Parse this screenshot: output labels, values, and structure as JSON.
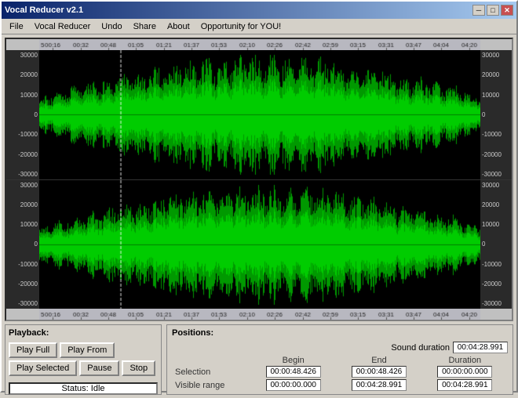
{
  "window": {
    "title": "Vocal Reducer v2.1",
    "minimize_label": "─",
    "maximize_label": "□",
    "close_label": "✕"
  },
  "menu": {
    "items": [
      {
        "label": "File"
      },
      {
        "label": "Vocal Reducer"
      },
      {
        "label": "Undo"
      },
      {
        "label": "Share"
      },
      {
        "label": "About"
      },
      {
        "label": "Opportunity for YOU!"
      }
    ]
  },
  "timeline": {
    "markers": [
      "00:16",
      "00:32",
      "00:48",
      "01:05",
      "01:21",
      "01:37",
      "01:53",
      "02:10",
      "02:26",
      "02:42",
      "02:59",
      "03:15",
      "03:31",
      "03:47",
      "04:04",
      "04:20"
    ]
  },
  "yaxis": {
    "channel1_left": [
      "30000",
      "20000",
      "10000",
      "0",
      "-10000",
      "-20000",
      "-30000"
    ],
    "channel1_right": [
      "30000",
      "20000",
      "10000",
      "0",
      "-10000",
      "-20000",
      "-30000"
    ],
    "channel2_left": [
      "30000",
      "20000",
      "10000",
      "0",
      "-10000",
      "-20000",
      "-30000"
    ],
    "channel2_right": [
      "30000",
      "20000",
      "10000",
      "0",
      "-10000",
      "-20000",
      "-30000"
    ]
  },
  "playback": {
    "label": "Playback:",
    "buttons": {
      "play_full": "Play Full",
      "play_from": "Play From",
      "play_selected": "Play Selected",
      "pause": "Pause",
      "stop": "Stop"
    }
  },
  "status": {
    "label": "Status: Idle"
  },
  "positions": {
    "label": "Positions:",
    "sound_duration_label": "Sound duration",
    "sound_duration_value": "00:04:28.991",
    "columns": {
      "begin": "Begin",
      "end": "End",
      "duration": "Duration"
    },
    "rows": {
      "selection": {
        "label": "Selection",
        "begin": "00:00:48.426",
        "end": "00:00:48.426",
        "duration": "00:00:00.000"
      },
      "visible_range": {
        "label": "Visible range",
        "begin": "00:00:00.000",
        "end": "00:04:28.991",
        "duration": "00:04:28.991"
      }
    }
  },
  "colors": {
    "waveform_green": "#00cc00",
    "waveform_dark_green": "#006600",
    "background": "#000000",
    "cursor_white": "#ffffff"
  }
}
